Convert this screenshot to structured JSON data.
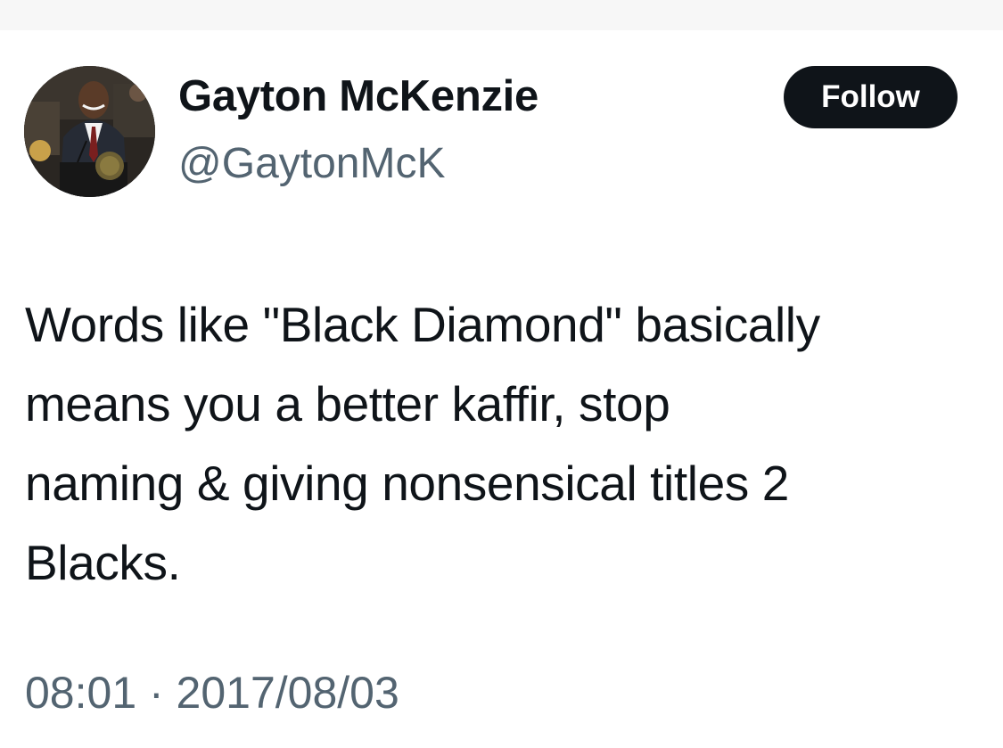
{
  "author": {
    "display_name": "Gayton McKenzie",
    "handle": "@GaytonMcK",
    "avatar_icon": "profile-photo-speaker-at-podium"
  },
  "follow_button": {
    "label": "Follow"
  },
  "tweet": {
    "text_lines": [
      "Words like \"Black Diamond\"  basically",
      "means you a better kaffir, stop",
      "naming & giving nonsensical titles 2",
      "Blacks."
    ],
    "timestamp": "08:01 · 2017/08/03"
  },
  "colors": {
    "text_primary": "#0f1419",
    "text_secondary": "#536471",
    "button_bg": "#0f1419",
    "button_text": "#ffffff",
    "top_strip": "#f7f7f7"
  }
}
